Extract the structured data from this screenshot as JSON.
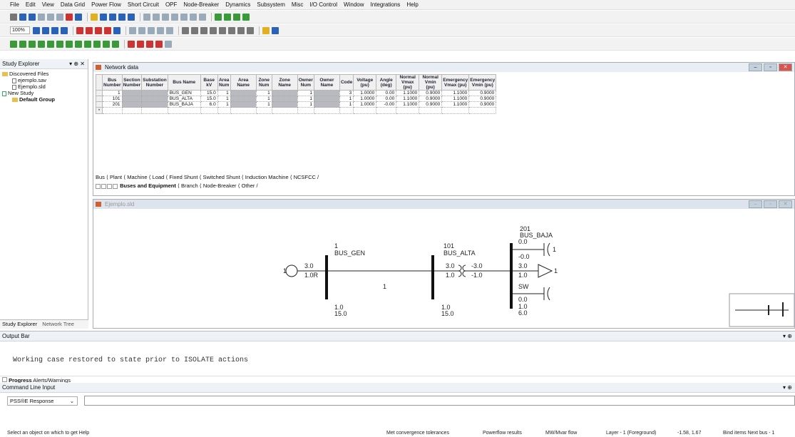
{
  "menu": [
    "File",
    "Edit",
    "View",
    "Data Grid",
    "Power Flow",
    "Short Circuit",
    "OPF",
    "Node-Breaker",
    "Dynamics",
    "Subsystem",
    "Misc",
    "I/O Control",
    "Window",
    "Integrations",
    "Help"
  ],
  "toolbar": {
    "zoom": "100%"
  },
  "explorer": {
    "title": "Study Explorer",
    "tree": [
      "Discovered Files",
      "ejemplo.sav",
      "Ejemplo.sld",
      "New Study",
      "Default Group"
    ],
    "tabs": [
      "Study Explorer",
      "Network Tree"
    ]
  },
  "network": {
    "title": "Network data",
    "columns": [
      "Bus Number",
      "Section Number",
      "Substation Number",
      "Bus Name",
      "Base kV",
      "Area Num",
      "Area Name",
      "Zone Num",
      "Zone Name",
      "Owner Num",
      "Owner Name",
      "Code",
      "Voltage (pu)",
      "Angle (deg)",
      "Normal Vmax (pu)",
      "Normal Vmin (pu)",
      "Emergency Vmax (pu)",
      "Emergency Vmin (pu)"
    ],
    "rows": [
      [
        "1",
        "",
        "",
        "BUS_GEN",
        "15.0",
        "1",
        "",
        "1",
        "",
        "1",
        "",
        "3",
        "1.0000",
        "0.00",
        "1.1000",
        "0.9000",
        "1.1000",
        "0.9000"
      ],
      [
        "101",
        "",
        "",
        "BUS_ALTA",
        "15.0",
        "1",
        "",
        "1",
        "",
        "1",
        "",
        "1",
        "1.0000",
        "0.00",
        "1.1000",
        "0.9000",
        "1.1000",
        "0.9000"
      ],
      [
        "201",
        "",
        "",
        "BUS_BAJA",
        "6.0",
        "1",
        "",
        "1",
        "",
        "1",
        "",
        "1",
        "1.0000",
        "-0.00",
        "1.1000",
        "0.9000",
        "1.1000",
        "0.9000"
      ]
    ],
    "new_row_marker": "*",
    "tabs1": "Bus ⟨ Plant ⟨ Machine ⟨ Load ⟨ Fixed Shunt ⟨ Switched Shunt ⟨ Induction Machine ⟨ NCSFCC /",
    "tabs2_active": "Buses and Equipment",
    "tabs2_rest": "⟨ Branch ⟨ Node-Breaker ⟨ Other /"
  },
  "diagram": {
    "title": "Ejemplo.sld",
    "bus_gen": {
      "num": "1",
      "name": "BUS_GEN",
      "v": "1.0",
      "kv": "15.0"
    },
    "bus_alta": {
      "num": "101",
      "name": "BUS_ALTA",
      "v": "1.0",
      "kv": "15.0"
    },
    "bus_baja": {
      "num": "201",
      "name": "BUS_BAJA",
      "v": "1.0",
      "kv": "6.0"
    },
    "gen": {
      "label": "1",
      "p": "3.0",
      "q": "1.0R"
    },
    "branch": {
      "label": "1"
    },
    "xfmr": {
      "p_from": "3.0",
      "q_from": "1.0",
      "p_to": "-3.0",
      "q_to": "-1.0"
    },
    "shunt": {
      "label": "1",
      "val": "0.0",
      "flow": "-0.0"
    },
    "load": {
      "label": "1",
      "p": "3.0",
      "q": "1.0"
    },
    "sw": {
      "label": "SW",
      "val": "0.0"
    }
  },
  "output": {
    "title": "Output Bar",
    "message": "Working case restored to state prior to ISOLATE actions",
    "tabs": [
      "Progress",
      "Alerts/Warnings"
    ]
  },
  "command": {
    "title": "Command Line Input",
    "mode": "PSS®E Response"
  },
  "status": {
    "help": "Select an object on which to get Help",
    "convergence": "Met convergence tolerances",
    "results": "Powerflow results",
    "flow": "MW/Mvar flow",
    "layer": "Layer - 1 (Foreground)",
    "coords": "-1.58, 1.67",
    "bind": "Bind items Next bus - 1"
  }
}
